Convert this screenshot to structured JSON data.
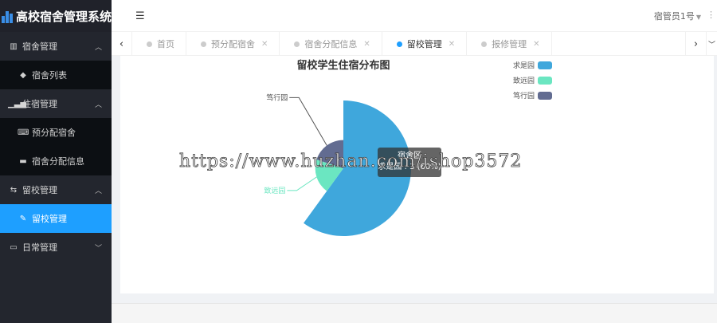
{
  "app": {
    "title": "高校宿舍管理系统"
  },
  "sidebar": {
    "groups": [
      {
        "title": "宿舍管理",
        "icon": "building-icon",
        "expanded": true,
        "items": [
          {
            "label": "宿舍列表",
            "icon": "cube-icon",
            "active": false
          }
        ]
      },
      {
        "title": "住宿管理",
        "icon": "bar-signal-icon",
        "expanded": true,
        "items": [
          {
            "label": "预分配宿舍",
            "icon": "keyboard-icon",
            "active": false
          },
          {
            "label": "宿舍分配信息",
            "icon": "bed-icon",
            "active": false
          }
        ]
      },
      {
        "title": "留校管理",
        "icon": "retweet-icon",
        "expanded": true,
        "items": [
          {
            "label": "留校管理",
            "icon": "edit-icon",
            "active": true
          }
        ]
      },
      {
        "title": "日常管理",
        "icon": "laptop-icon",
        "expanded": false,
        "items": []
      }
    ]
  },
  "header": {
    "user": "宿管员1号"
  },
  "tabs": [
    {
      "label": "首页",
      "closable": false,
      "active": false
    },
    {
      "label": "预分配宿舍",
      "closable": true,
      "active": false
    },
    {
      "label": "宿舍分配信息",
      "closable": true,
      "active": false
    },
    {
      "label": "留校管理",
      "closable": true,
      "active": true
    },
    {
      "label": "报修管理",
      "closable": true,
      "active": false
    }
  ],
  "tooltip": {
    "title": "宿舍区",
    "line": "求是园 : 3 (60%)"
  },
  "watermark": "https://www.huzhan.com/ishop3572",
  "chart_data": {
    "type": "pie",
    "title": "留校学生住宿分布图",
    "rose_type": "radius",
    "legend_position": "top-right",
    "series_name": "宿舍区",
    "categories": [
      "求是园",
      "致远园",
      "笃行园"
    ],
    "values": [
      3,
      1,
      1
    ],
    "colors": [
      "#3fa7dc",
      "#6be6c1",
      "#626c91"
    ]
  }
}
